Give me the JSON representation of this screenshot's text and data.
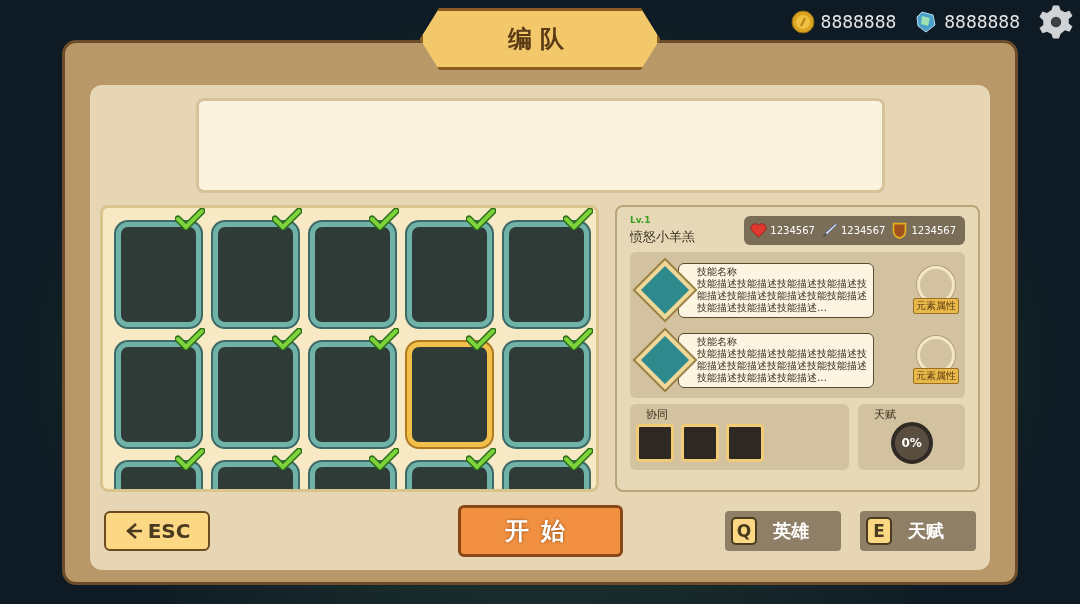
{
  "title": "编队",
  "currencies": [
    {
      "kind": "coin",
      "amount": "8888888"
    },
    {
      "kind": "gem",
      "amount": "8888888"
    }
  ],
  "cards": [
    {
      "checked": true,
      "selected": false
    },
    {
      "checked": true,
      "selected": false
    },
    {
      "checked": true,
      "selected": false
    },
    {
      "checked": true,
      "selected": false
    },
    {
      "checked": true,
      "selected": false
    },
    {
      "checked": true,
      "selected": false
    },
    {
      "checked": true,
      "selected": false
    },
    {
      "checked": true,
      "selected": false
    },
    {
      "checked": true,
      "selected": true
    },
    {
      "checked": true,
      "selected": false
    },
    {
      "checked": true,
      "selected": false
    },
    {
      "checked": true,
      "selected": false
    },
    {
      "checked": true,
      "selected": false
    },
    {
      "checked": true,
      "selected": false
    },
    {
      "checked": true,
      "selected": false
    }
  ],
  "hero": {
    "level": "Lv.1",
    "name": "愤怒小羊羔",
    "stats": [
      {
        "kind": "heart",
        "value": "1234567"
      },
      {
        "kind": "sword",
        "value": "1234567"
      },
      {
        "kind": "shield",
        "value": "1234567"
      }
    ],
    "skills": [
      {
        "name": "技能名称",
        "description": "技能描述技能描述技能描述技能描述技能描述技能描述技能描述技能技能描述技能描述技能描述技能描述…",
        "element": "元素属性"
      },
      {
        "name": "技能名称",
        "description": "技能描述技能描述技能描述技能描述技能描述技能描述技能描述技能技能描述技能描述技能描述技能描述…",
        "element": "元素属性"
      }
    ],
    "synergy": {
      "label": "协同"
    },
    "talent": {
      "label": "天赋",
      "value": "0%"
    }
  },
  "buttons": {
    "back": "ESC",
    "start": "开始",
    "hotkeys": [
      {
        "key": "Q",
        "label": "英雄"
      },
      {
        "key": "E",
        "label": "天赋"
      }
    ]
  }
}
